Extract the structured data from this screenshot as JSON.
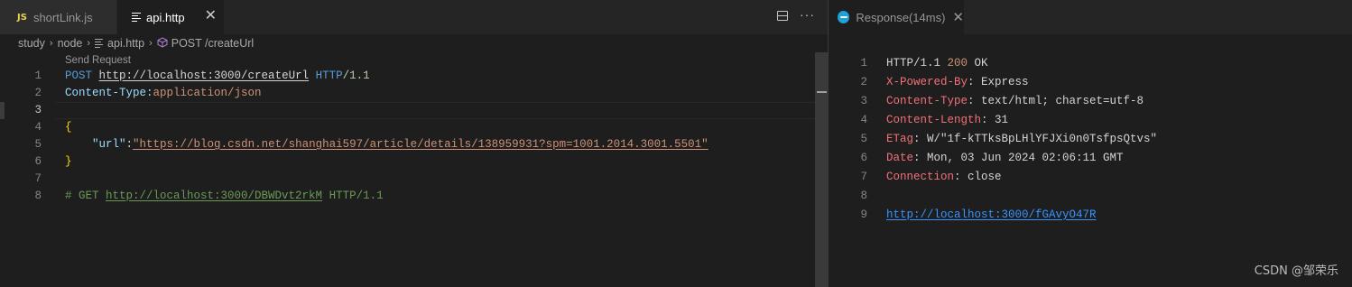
{
  "tabs": {
    "shortlink": {
      "badge": "JS",
      "label": "shortLink.js"
    },
    "apihttp": {
      "label": "api.http",
      "close": "✕"
    }
  },
  "toolbar": {
    "more": "···"
  },
  "breadcrumb": {
    "items": [
      "study",
      "node",
      "api.http",
      "POST /createUrl"
    ],
    "separator": "›"
  },
  "editor": {
    "codelens": "Send Request",
    "line_numbers": [
      "1",
      "2",
      "3",
      "4",
      "5",
      "6",
      "7",
      "8"
    ],
    "line1": {
      "method": "POST",
      "url": "http://localhost:3000/createUrl",
      "proto": "HTTP",
      "version": "/1.1"
    },
    "line2": {
      "header": "Content-Type:",
      "value": "application/json"
    },
    "line4": "{",
    "line5": {
      "key": "\"url\"",
      "colon": ":",
      "value": "\"https://blog.csdn.net/shanghai597/article/details/138959931?spm=1001.2014.3001.5501\""
    },
    "line6": "}",
    "line8": {
      "prefix": "# GET ",
      "url": "http://localhost:3000/DBWDvt2rkM",
      "suffix": " HTTP/1.1"
    }
  },
  "response": {
    "tab_label": "Response(14ms)",
    "tab_close": "✕",
    "line_numbers": [
      "1",
      "2",
      "3",
      "4",
      "5",
      "6",
      "7",
      "8",
      "9"
    ],
    "status": {
      "proto": "HTTP/1.1 ",
      "code": "200",
      "text": " OK"
    },
    "headers": [
      {
        "key": "X-Powered-By",
        "value": ": Express"
      },
      {
        "key": "Content-Type",
        "value": ": text/html; charset=utf-8"
      },
      {
        "key": "Content-Length",
        "value": ": 31"
      },
      {
        "key": "ETag",
        "value": ": W/\"1f-kTTksBpLHlYFJXi0n0TsfpsQtvs\""
      },
      {
        "key": "Date",
        "value": ": Mon, 03 Jun 2024 02:06:11 GMT"
      },
      {
        "key": "Connection",
        "value": ": close"
      }
    ],
    "body_link": "http://localhost:3000/fGAvyO47R"
  },
  "watermark": "CSDN @邹荣乐",
  "colors": {
    "background": "#1e1e1e",
    "keyword": "#569cd6",
    "string": "#ce9178",
    "comment": "#6a9955",
    "link": "#3794ff"
  }
}
